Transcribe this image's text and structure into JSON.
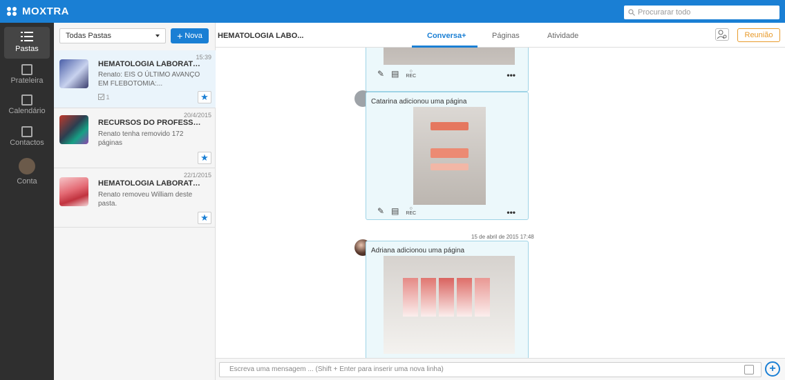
{
  "app": {
    "logo_text": "MOXTRA",
    "search_placeholder": "Procurarar todo"
  },
  "nav": [
    {
      "label": "Pastas",
      "icon": "folders-icon"
    },
    {
      "label": "Prateleira",
      "icon": "shelf-icon"
    },
    {
      "label": "Calendário",
      "icon": "calendar-icon"
    },
    {
      "label": "Contactos",
      "icon": "contacts-icon"
    },
    {
      "label": "Conta",
      "icon": "avatar-icon"
    }
  ],
  "folders": {
    "filter_label": "Todas Pastas",
    "new_label": "Nova",
    "items": [
      {
        "time": "15:39",
        "title": "HEMATOLOGIA LABORATORI...",
        "subtitle": "Renato: EIS O ÚLTIMO AVANÇO EM FLEBOTOMIA:...",
        "meta": "1"
      },
      {
        "time": "20/4/2015",
        "title": "RECURSOS DO PROFESSOR",
        "subtitle": "Renato tenha removido 172 páginas",
        "meta": ""
      },
      {
        "time": "22/1/2015",
        "title": "HEMATOLOGIA LABORATORI...",
        "subtitle": "Renato removeu William deste pasta.",
        "meta": ""
      }
    ]
  },
  "main": {
    "title": "HEMATOLOGIA LABO...",
    "tabs": [
      "Conversa+",
      "Páginas",
      "Atividade"
    ],
    "meeting_label": "Reunião",
    "feed": [
      {
        "title": "",
        "rec": "REC"
      },
      {
        "title": "Catarina adicionou uma página",
        "rec": "REC"
      },
      {
        "date": "15 de abril de 2015 17:48",
        "title": "Adriana adicionou uma página"
      }
    ],
    "composer_placeholder": "Escreva uma mensagem ... (Shift + Enter para inserir uma nova linha)"
  },
  "colors": {
    "accent": "#1a7fd4",
    "meeting": "#e89a2a",
    "card_bg": "#ecf8fb",
    "card_border": "#9ed3e6"
  }
}
